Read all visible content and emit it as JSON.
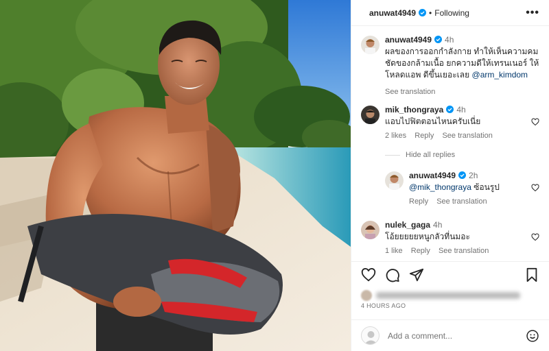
{
  "post": {
    "author": "anuwat4949",
    "follow_status": "Following",
    "separator": "•",
    "more_label": "•••"
  },
  "caption": {
    "author": "anuwat4949",
    "time": "4h",
    "text": "ผลของการออกกำลังกาย ทำให้เห็นความคมชัดของกล้ามเนื้อ ยกความดีให้เทรนเนอร์ ให้โหลดแอพ ดีขึ้นเยอะเลย",
    "mention": "@arm_kimdom",
    "see_translation": "See translation"
  },
  "comments": [
    {
      "author": "mik_thongraya",
      "time": "4h",
      "text": "แอบไปฟิตตอนไหนครับเนี่ย",
      "likes": "2 likes",
      "reply": "Reply",
      "see_translation": "See translation"
    },
    {
      "author": "nulek_gaga",
      "time": "4h",
      "text": "โอ้ยยยยยหนูกลัวที่นมอะ",
      "likes": "1 like",
      "reply": "Reply",
      "see_translation": "See translation"
    }
  ],
  "hide_replies": "Hide all replies",
  "reply": {
    "author": "anuwat4949",
    "time": "2h",
    "mention": "@mik_thongraya",
    "text": " ซ้อนรูป",
    "reply": "Reply",
    "see_translation": "See translation"
  },
  "footer": {
    "time_ago": "4 HOURS AGO",
    "add_comment_placeholder": "Add a comment..."
  },
  "colors": {
    "verified": "#0095f6",
    "link": "#00376b",
    "secondary_text": "#737373"
  },
  "icons": [
    "verified-badge-icon",
    "more-icon",
    "heart-icon",
    "comment-icon",
    "share-icon",
    "bookmark-icon",
    "emoji-icon"
  ]
}
